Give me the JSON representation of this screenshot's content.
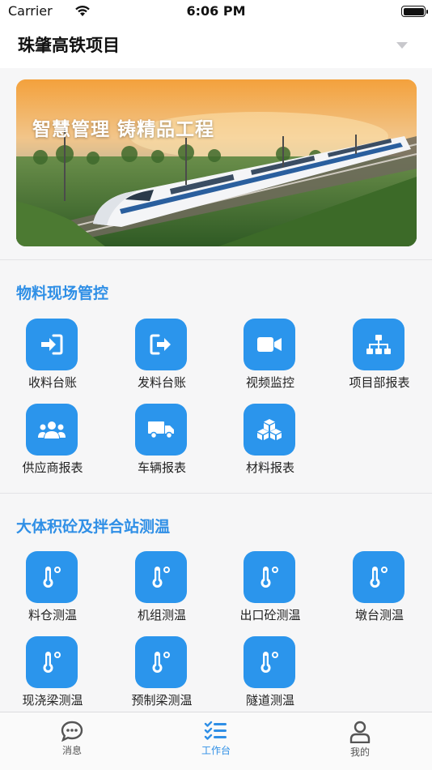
{
  "status_bar": {
    "carrier": "Carrier",
    "time": "6:06 PM"
  },
  "header": {
    "project_name": "珠肇高铁项目"
  },
  "banner": {
    "slogan": "智慧管理 铸精品工程"
  },
  "sections": [
    {
      "title": "物料现场管控",
      "items": [
        {
          "label": "收料台账",
          "icon": "sign-in-icon"
        },
        {
          "label": "发料台账",
          "icon": "sign-out-icon"
        },
        {
          "label": "视频监控",
          "icon": "video-camera-icon"
        },
        {
          "label": "项目部报表",
          "icon": "org-chart-icon"
        },
        {
          "label": "供应商报表",
          "icon": "users-group-icon"
        },
        {
          "label": "车辆报表",
          "icon": "truck-icon"
        },
        {
          "label": "材料报表",
          "icon": "cubes-icon"
        }
      ]
    },
    {
      "title": "大体积砼及拌合站测温",
      "items": [
        {
          "label": "料仓测温",
          "icon": "thermometer-icon"
        },
        {
          "label": "机组测温",
          "icon": "thermometer-icon"
        },
        {
          "label": "出口砼测温",
          "icon": "thermometer-icon"
        },
        {
          "label": "墩台测温",
          "icon": "thermometer-icon"
        },
        {
          "label": "现浇梁测温",
          "icon": "thermometer-icon"
        },
        {
          "label": "预制梁测温",
          "icon": "thermometer-icon"
        },
        {
          "label": "隧道测温",
          "icon": "thermometer-icon"
        }
      ]
    }
  ],
  "tab_bar": {
    "tabs": [
      {
        "label": "消息",
        "icon": "chat-bubble-icon",
        "active": false
      },
      {
        "label": "工作台",
        "icon": "checklist-icon",
        "active": true
      },
      {
        "label": "我的",
        "icon": "user-icon",
        "active": false
      }
    ]
  },
  "colors": {
    "accent": "#2f8fe6",
    "tile": "#2b95ec",
    "background": "#f6f6f7"
  }
}
